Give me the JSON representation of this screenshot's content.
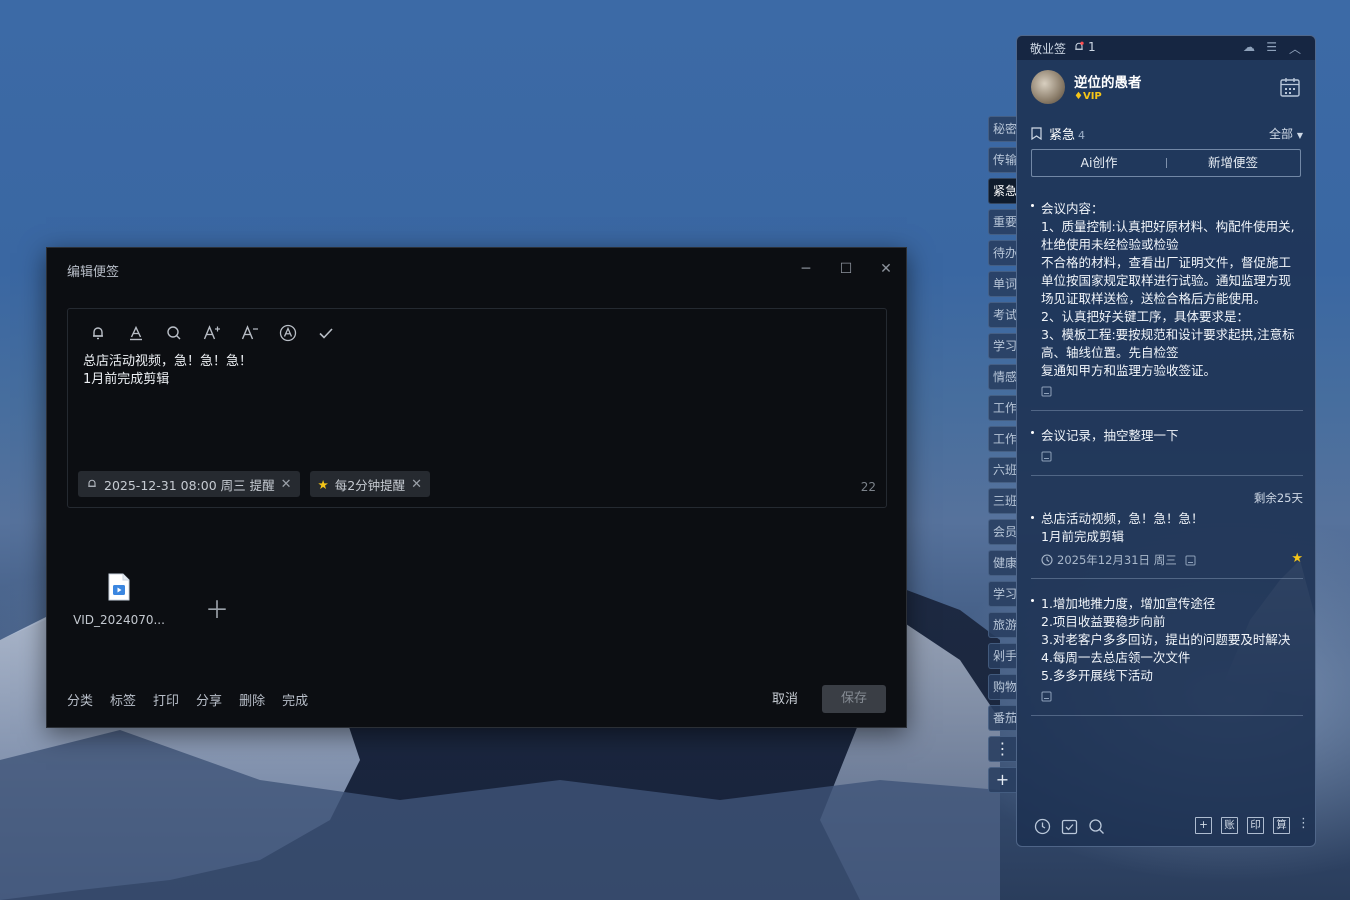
{
  "editor": {
    "title": "编辑便签",
    "content_lines": [
      "总店活动视频，急！急！急！",
      "1月前完成剪辑"
    ],
    "reminder_chip": "2025-12-31 08:00 周三 提醒",
    "repeat_chip": "每2分钟提醒",
    "char_count": "22",
    "attachment_name": "VID_2024070...",
    "footer_actions": [
      "分类",
      "标签",
      "打印",
      "分享",
      "删除",
      "完成"
    ],
    "cancel_label": "取消",
    "save_label": "保存"
  },
  "tabs": [
    "秘密",
    "传输",
    "紧急",
    "重要",
    "待办",
    "单词",
    "考试",
    "学习",
    "情感",
    "工作",
    "工作",
    "六班",
    "三班",
    "会员",
    "健康",
    "学习",
    "旅游",
    "剁手",
    "购物",
    "番茄"
  ],
  "panel": {
    "app_name": "敬业签",
    "notify_count": "1",
    "user_name": "逆位的愚者",
    "vip_label": "VIP",
    "category": "紧急",
    "category_count": "4",
    "filter_label": "全部",
    "ai_button": "Ai创作",
    "new_button": "新增便签",
    "notes": [
      {
        "lines": [
          "会议内容：",
          "1、质量控制:认真把好原材料、构配件使用关,杜绝使用未经检验或检验",
          "不合格的材料，查看出厂证明文件，督促施工单位按国家规定取样进行试验。通知监理方现场见证取样送检，送检合格后方能使用。",
          "2、认真把好关键工序，具体要求是：",
          "3、模板工程:要按规范和设计要求起拱,注意标高、轴线位置。先自检签",
          "复通知甲方和监理方验收签证。"
        ]
      },
      {
        "lines": [
          "会议记录，抽空整理一下"
        ]
      },
      {
        "remaining": "剩余25天",
        "lines": [
          "总店活动视频，急！急！急！",
          "1月前完成剪辑"
        ],
        "reminder": "2025年12月31日 周三"
      },
      {
        "lines": [
          "1.增加地推力度，增加宣传途径",
          "2.项目收益要稳步向前",
          "3.对老客户多多回访，提出的问题要及时解决",
          "4.每周一去总店领一次文件",
          "5.多多开展线下活动"
        ]
      }
    ],
    "bottom_boxes": [
      "+",
      "账",
      "印",
      "算"
    ]
  }
}
